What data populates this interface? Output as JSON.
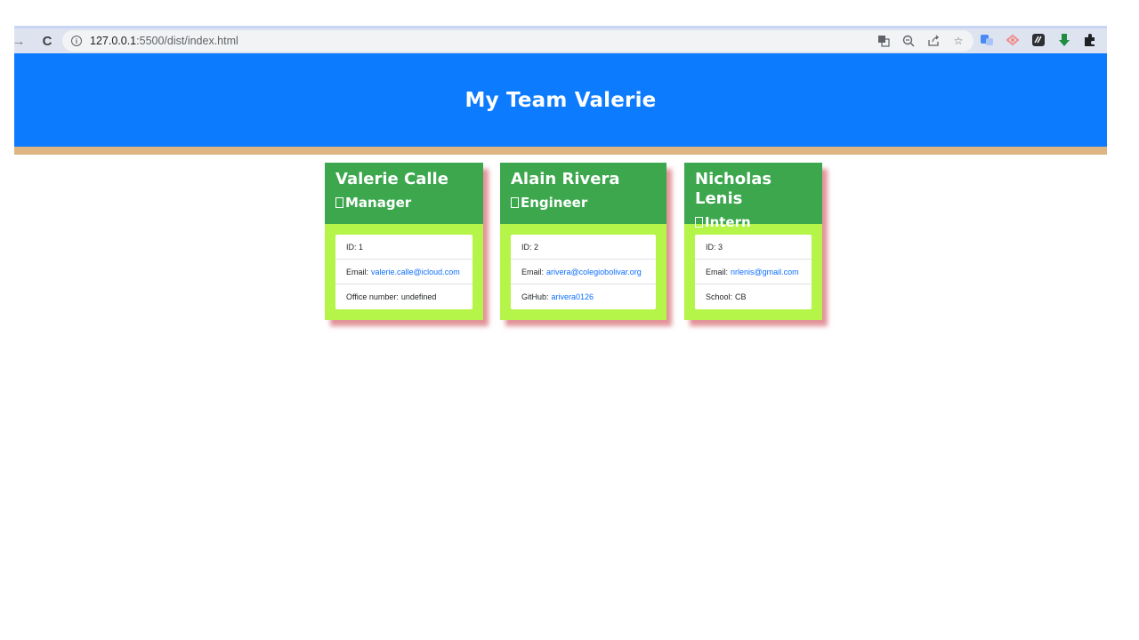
{
  "browser": {
    "url_host": "127.0.0.1",
    "url_path": ":5500/dist/index.html",
    "back_icon": "arrow-right-icon",
    "reload_icon": "reload-icon"
  },
  "header": {
    "title": "My Team Valerie"
  },
  "employees": [
    {
      "name": "Valerie Calle",
      "role": "Manager",
      "id_label": "ID: 1",
      "email_label": "Email:",
      "email": "valerie.calle@icloud.com",
      "extra_label": "Office number:",
      "extra_value": "undefined"
    },
    {
      "name": "Alain Rivera",
      "role": "Engineer",
      "id_label": "ID: 2",
      "email_label": "Email:",
      "email": "arivera@colegiobolivar.org",
      "extra_label": "GitHub:",
      "extra_value": "arivera0126"
    },
    {
      "name": "Nicholas Lenis",
      "role": "Intern",
      "id_label": "ID: 3",
      "email_label": "Email:",
      "email": "nrlenis@gmail.com",
      "extra_label": "School:",
      "extra_value": "CB"
    }
  ],
  "colors": {
    "header_bg": "#0d7bfe",
    "header_stripe": "#dcb583",
    "card_head": "#3ca74d",
    "card_body": "#b5f54a",
    "link": "#0d6efd"
  }
}
